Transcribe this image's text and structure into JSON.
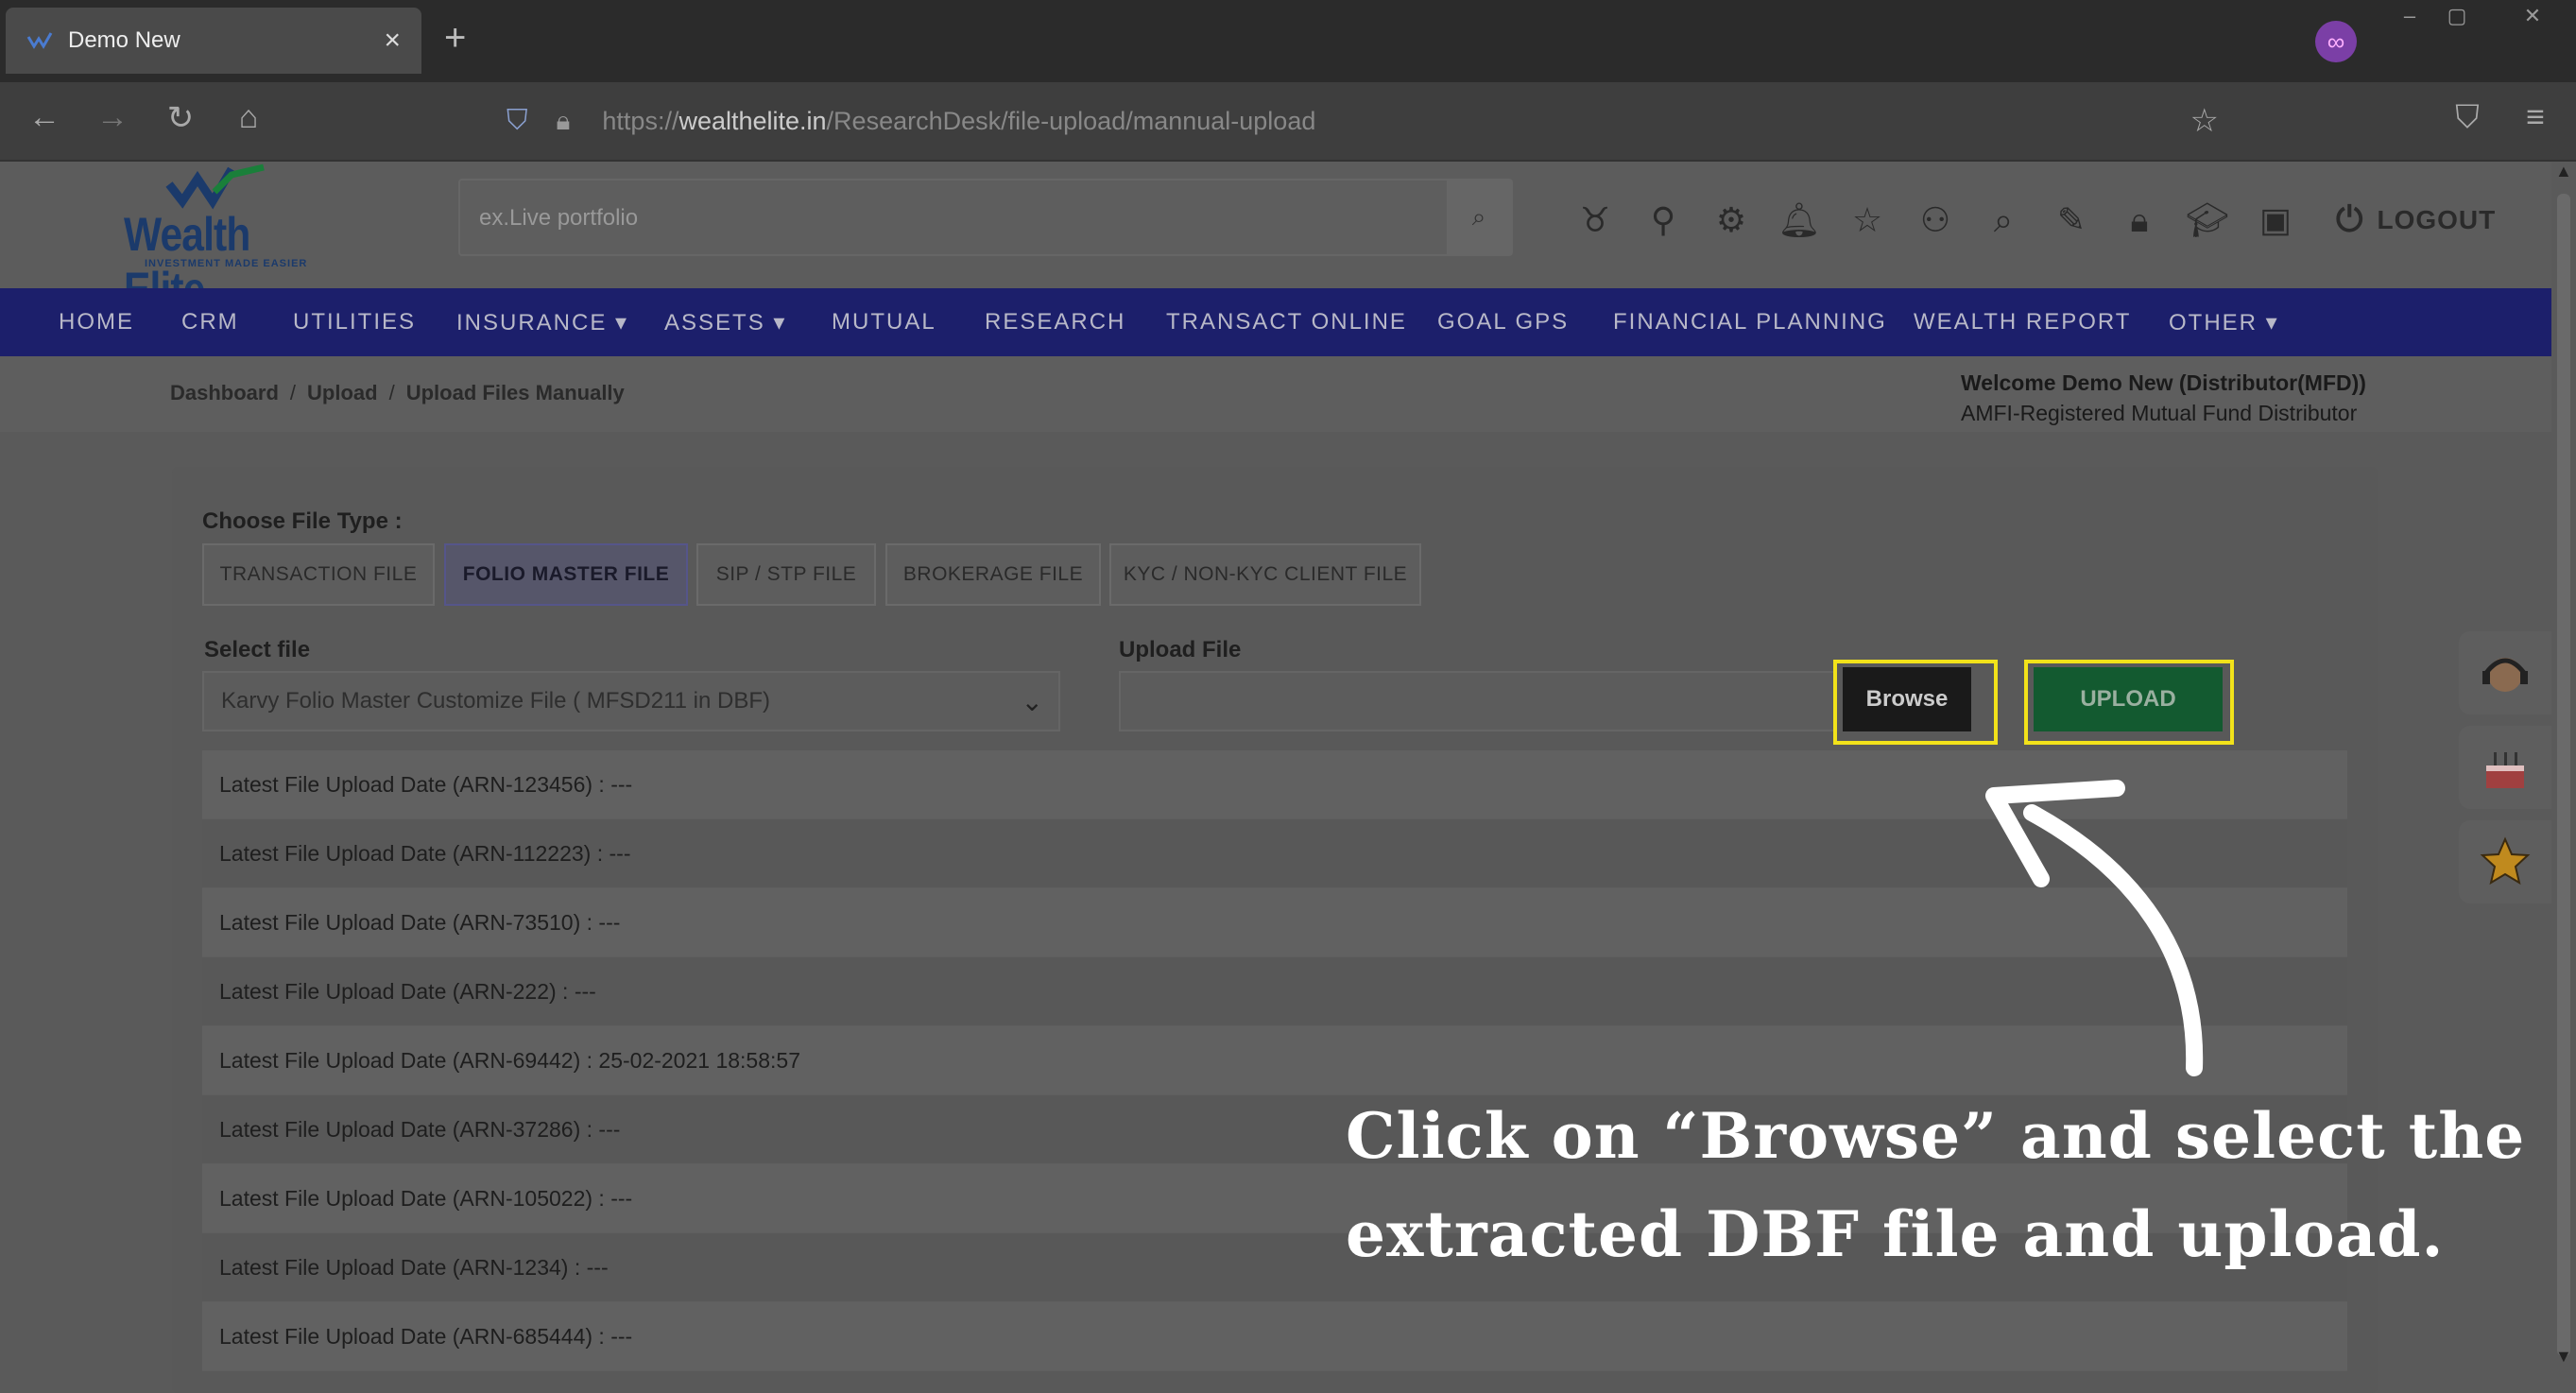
{
  "browser": {
    "tab_title": "Demo New",
    "tab_close": "×",
    "new_tab": "+",
    "url_host": "wealthelite.in",
    "url_prefix": "https://",
    "url_path": "/ResearchDesk/file-upload/mannual-upload"
  },
  "header": {
    "logo_name": "Wealth Elite",
    "logo_tagline": "INVESTMENT MADE EASIER",
    "search_placeholder": "ex.Live portfolio",
    "logout_label": "LOGOUT"
  },
  "menu": {
    "items": [
      "HOME",
      "CRM",
      "UTILITIES",
      "INSURANCE ▾",
      "ASSETS ▾",
      "MUTUAL",
      "RESEARCH",
      "TRANSACT ONLINE",
      "GOAL GPS",
      "FINANCIAL PLANNING",
      "WEALTH REPORT",
      "OTHER ▾"
    ]
  },
  "breadcrumb": {
    "items": [
      "Dashboard",
      "Upload",
      "Upload Files Manually"
    ],
    "sep": "/"
  },
  "welcome": {
    "line1": "Welcome Demo New (Distributor(MFD))",
    "line2": "AMFI-Registered Mutual Fund Distributor"
  },
  "form": {
    "choose_label": "Choose File Type :",
    "file_types": [
      "TRANSACTION FILE",
      "FOLIO MASTER FILE",
      "SIP / STP FILE",
      "BROKERAGE FILE",
      "KYC / NON-KYC CLIENT FILE"
    ],
    "active_type": "FOLIO MASTER FILE",
    "select_label": "Select file",
    "select_value": "Karvy Folio Master Customize File ( MFSD211 in DBF)",
    "upload_label": "Upload File",
    "browse_label": "Browse",
    "upload_button": "UPLOAD"
  },
  "upload_dates": [
    "Latest File Upload Date (ARN-123456) : ---",
    "Latest File Upload Date (ARN-112223) : ---",
    "Latest File Upload Date (ARN-73510) : ---",
    "Latest File Upload Date (ARN-222) : ---",
    "Latest File Upload Date (ARN-69442) : 25-02-2021 18:58:57",
    "Latest File Upload Date (ARN-37286) : ---",
    "Latest File Upload Date (ARN-105022) : ---",
    "Latest File Upload Date (ARN-1234) : ---",
    "Latest File Upload Date (ARN-685444) : ---"
  ],
  "annotation": {
    "text": "Click on “Browse” and select the extracted DBF file and upload.",
    "highlight_color": "#f2e21a"
  }
}
